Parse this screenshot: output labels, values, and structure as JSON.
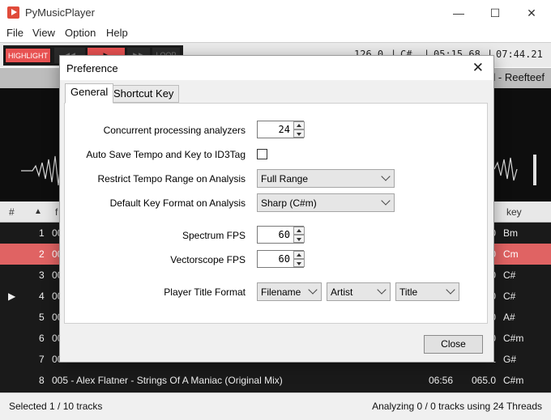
{
  "window": {
    "title": "PyMusicPlayer",
    "minimize": "—",
    "maximize": "☐",
    "close": "✕"
  },
  "menu": [
    "File",
    "View",
    "Option",
    "Help"
  ],
  "toolbar": {
    "highlight": "HIGHLIGHT",
    "loop": "LOOP",
    "tempo": "126.0",
    "key": "C#",
    "position": "05:15.68",
    "duration": "07:44.21",
    "separator": "|"
  },
  "now_playing": "d - Reefteef",
  "table": {
    "headers": {
      "num": "#",
      "sort_arrow": "▲",
      "file": "f",
      "key": "key"
    },
    "rows": [
      {
        "num": "1",
        "file": "00",
        "tail": "0",
        "key": "Bm",
        "marker": ""
      },
      {
        "num": "2",
        "file": "00",
        "tail": "0",
        "key": "Cm",
        "marker": "",
        "selected": true
      },
      {
        "num": "3",
        "file": "00",
        "tail": "0",
        "key": "C#",
        "marker": ""
      },
      {
        "num": "4",
        "file": "00",
        "tail": "0",
        "key": "C#",
        "marker": "▶"
      },
      {
        "num": "5",
        "file": "00",
        "tail": "0",
        "key": "A#",
        "marker": ""
      },
      {
        "num": "6",
        "file": "00",
        "tail": "0",
        "key": "C#m",
        "marker": ""
      },
      {
        "num": "7",
        "file": "00",
        "tail": "1",
        "key": "G#",
        "marker": ""
      },
      {
        "num": "8",
        "file": "005 - Alex Flatner - Strings Of A Maniac (Original Mix)",
        "time": "06:56",
        "tail": "065.0",
        "key": "C#m",
        "marker": ""
      }
    ]
  },
  "status": {
    "left": "Selected 1 / 10 tracks",
    "right": "Analyzing 0 / 0 tracks using 24 Threads"
  },
  "dialog": {
    "title": "Preference",
    "close_icon": "✕",
    "tabs": [
      "General",
      "Shortcut Key"
    ],
    "fields": {
      "concurrent_label": "Concurrent processing analyzers",
      "concurrent_value": "24",
      "autosave_label": "Auto Save Tempo and Key to ID3Tag",
      "restrict_label": "Restrict Tempo Range on Analysis",
      "restrict_value": "Full Range",
      "keyformat_label": "Default Key Format on Analysis",
      "keyformat_value": "Sharp (C#m)",
      "spectrum_label": "Spectrum FPS",
      "spectrum_value": "60",
      "vector_label": "Vectorscope FPS",
      "vector_value": "60",
      "titlefmt_label": "Player Title Format",
      "titlefmt_values": [
        "Filename",
        "Artist",
        "Title"
      ]
    },
    "close_button": "Close"
  },
  "colors": {
    "accent": "#e06363",
    "highlight": "#e85252"
  }
}
